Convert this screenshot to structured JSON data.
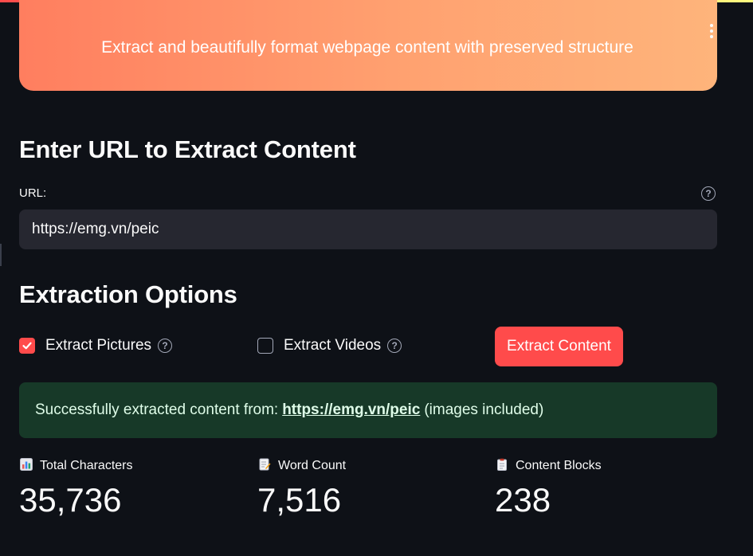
{
  "header": {
    "subtitle": "Extract and beautifully format webpage content with preserved structure"
  },
  "url_section": {
    "heading": "Enter URL to Extract Content",
    "label": "URL:",
    "value": "https://emg.vn/peic"
  },
  "options": {
    "heading": "Extraction Options",
    "extract_pictures": {
      "label": "Extract Pictures",
      "checked": true
    },
    "extract_videos": {
      "label": "Extract Videos",
      "checked": false
    },
    "button_label": "Extract Content"
  },
  "status": {
    "prefix": "Successfully extracted content from:",
    "link": "https://emg.vn/peic",
    "suffix": "(images included)"
  },
  "metrics": [
    {
      "icon": "bar-chart-icon",
      "label": "Total Characters",
      "value": "35,736"
    },
    {
      "icon": "memo-icon",
      "label": "Word Count",
      "value": "7,516"
    },
    {
      "icon": "clipboard-icon",
      "label": "Content Blocks",
      "value": "238"
    }
  ],
  "colors": {
    "accent": "#ff4b4b",
    "background": "#0e1117",
    "success_bg": "#173928"
  }
}
